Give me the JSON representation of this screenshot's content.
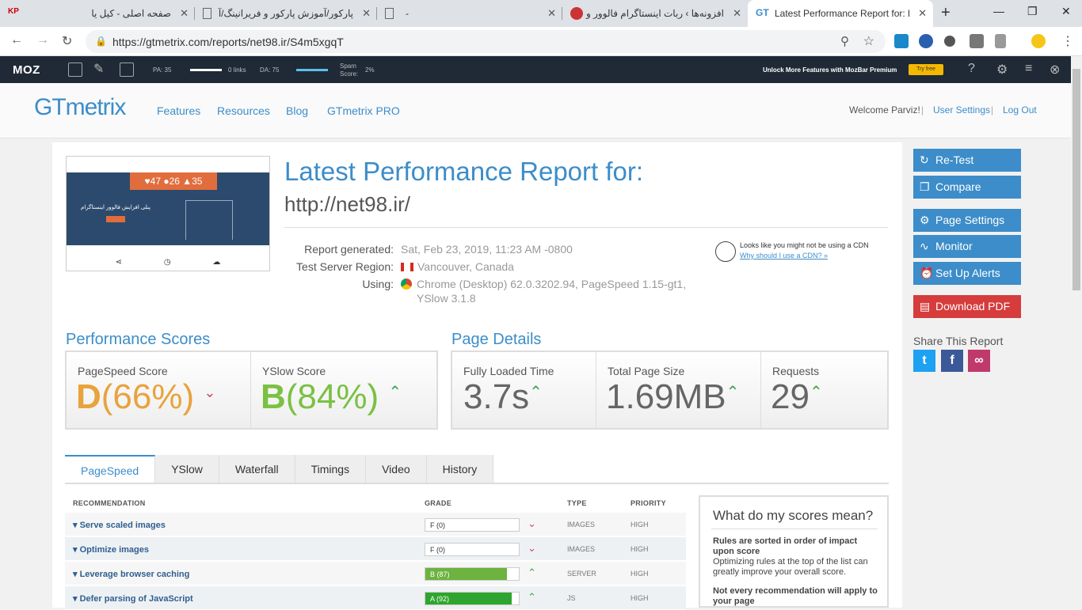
{
  "browser": {
    "tabs": [
      {
        "title": "صفحه اصلی - کیل یا"
      },
      {
        "title": "پارکور/آموزش پارکور و فریرانینگ/آ"
      },
      {
        "title": "-"
      },
      {
        "title": "افزونه‌ها › ربات اینستاگرام فالوور و"
      },
      {
        "title": "Latest Performance Report for: h"
      }
    ],
    "url": "https://gtmetrix.com/reports/net98.ir/S4m5xgqT"
  },
  "mozbar": {
    "logo": "MOZ",
    "pa": "PA: 35",
    "links": "0 links",
    "da": "DA: 75",
    "spam_label": "Spam Score:",
    "spam_value": "2%",
    "premium": "Unlock More Features with MozBar Premium",
    "try": "Try free"
  },
  "header": {
    "logo": "GTmetrix",
    "nav": [
      "Features",
      "Resources",
      "Blog",
      "GTmetrix PRO"
    ],
    "welcome": "Welcome Parviz!",
    "settings": "User Settings",
    "logout": "Log Out"
  },
  "thumb": {
    "counts": "♥47 ●26 ▲35",
    "caption": "پنلی افزایش فالوور اینستاگرام"
  },
  "report": {
    "title": "Latest Performance Report for:",
    "url": "http://net98.ir/",
    "generated_label": "Report generated:",
    "generated_value": "Sat, Feb 23, 2019, 11:23 AM -0800",
    "region_label": "Test Server Region:",
    "region_value": "Vancouver, Canada",
    "using_label": "Using:",
    "using_value": "Chrome (Desktop) 62.0.3202.94, PageSpeed 1.15-gt1,",
    "using_value2": "YSlow 3.1.8",
    "cdn_text": "Looks like you might not be using a CDN",
    "cdn_link": "Why should I use a CDN? »"
  },
  "scores": {
    "title": "Performance Scores",
    "pagespeed_label": "PageSpeed Score",
    "pagespeed_grade": "D",
    "pagespeed_pct": "(66%)",
    "yslow_label": "YSlow Score",
    "yslow_grade": "B",
    "yslow_pct": "(84%)",
    "colors": {
      "d": "#e8a33d",
      "b": "#7ac143"
    }
  },
  "details": {
    "title": "Page Details",
    "load_label": "Fully Loaded Time",
    "load_value": "3.7s",
    "size_label": "Total Page Size",
    "size_value": "1.69MB",
    "req_label": "Requests",
    "req_value": "29"
  },
  "sidebar": {
    "retest": "Re-Test",
    "compare": "Compare",
    "page_settings": "Page Settings",
    "monitor": "Monitor",
    "alerts": "Set Up Alerts",
    "pdf": "Download PDF",
    "share": "Share This Report"
  },
  "tabs": [
    "PageSpeed",
    "YSlow",
    "Waterfall",
    "Timings",
    "Video",
    "History"
  ],
  "table": {
    "headers": {
      "rec": "RECOMMENDATION",
      "grade": "GRADE",
      "type": "TYPE",
      "priority": "PRIORITY"
    },
    "rows": [
      {
        "name": "Serve scaled images",
        "grade": "F (0)",
        "pct": 0,
        "type": "IMAGES",
        "priority": "HIGH"
      },
      {
        "name": "Optimize images",
        "grade": "F (0)",
        "pct": 0,
        "type": "IMAGES",
        "priority": "HIGH"
      },
      {
        "name": "Leverage browser caching",
        "grade": "B (87)",
        "pct": 87,
        "type": "SERVER",
        "priority": "HIGH"
      },
      {
        "name": "Defer parsing of JavaScript",
        "grade": "A (92)",
        "pct": 92,
        "type": "JS",
        "priority": "HIGH"
      }
    ]
  },
  "scorebox": {
    "title": "What do my scores mean?",
    "b1": "Rules are sorted in order of impact upon score",
    "p1": "Optimizing rules at the top of the list can greatly improve your overall score.",
    "b2": "Not every recommendation will apply to your page"
  }
}
